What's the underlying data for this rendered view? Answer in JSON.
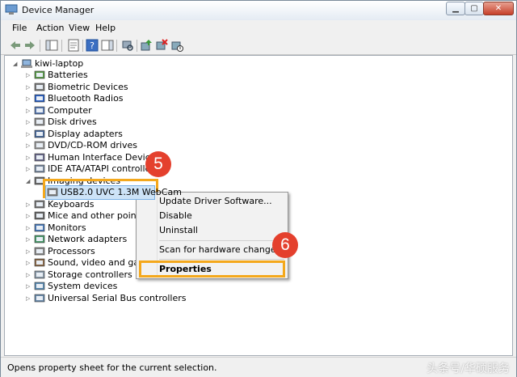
{
  "window": {
    "title": "Device Manager"
  },
  "menu": [
    "File",
    "Action",
    "View",
    "Help"
  ],
  "tree": {
    "root": "kiwi-laptop",
    "categories": [
      {
        "label": "Batteries",
        "icon": "battery-icon"
      },
      {
        "label": "Biometric Devices",
        "icon": "fingerprint-icon"
      },
      {
        "label": "Bluetooth Radios",
        "icon": "bluetooth-icon"
      },
      {
        "label": "Computer",
        "icon": "computer-icon"
      },
      {
        "label": "Disk drives",
        "icon": "disk-drive-icon"
      },
      {
        "label": "Display adapters",
        "icon": "display-adapter-icon"
      },
      {
        "label": "DVD/CD-ROM drives",
        "icon": "dvd-drive-icon"
      },
      {
        "label": "Human Interface Devices",
        "icon": "hid-icon"
      },
      {
        "label": "IDE ATA/ATAPI controllers",
        "icon": "ide-controller-icon"
      },
      {
        "label": "Imaging devices",
        "icon": "camera-icon"
      },
      {
        "label": "USB2.0 UVC 1.3M WebCam",
        "icon": "webcam-icon"
      },
      {
        "label": "Keyboards",
        "icon": "keyboard-icon"
      },
      {
        "label": "Mice and other pointing d",
        "icon": "mouse-icon"
      },
      {
        "label": "Monitors",
        "icon": "monitor-icon"
      },
      {
        "label": "Network adapters",
        "icon": "network-adapter-icon"
      },
      {
        "label": "Processors",
        "icon": "processor-icon"
      },
      {
        "label": "Sound, video and game co",
        "icon": "sound-icon"
      },
      {
        "label": "Storage controllers",
        "icon": "storage-controller-icon"
      },
      {
        "label": "System devices",
        "icon": "system-device-icon"
      },
      {
        "label": "Universal Serial Bus controllers",
        "icon": "usb-icon"
      }
    ]
  },
  "context_menu": {
    "update": "Update Driver Software...",
    "disable": "Disable",
    "uninstall": "Uninstall",
    "scan": "Scan for hardware changes",
    "properties": "Properties"
  },
  "callouts": {
    "step1": "5",
    "step2": "6"
  },
  "status": {
    "text": "Opens property sheet for the current selection."
  },
  "watermark": "头条号/华硕服务",
  "colors": {
    "callout_border": "#f4a81c",
    "badge": "#e4402d",
    "selection": "#cde3f7"
  }
}
